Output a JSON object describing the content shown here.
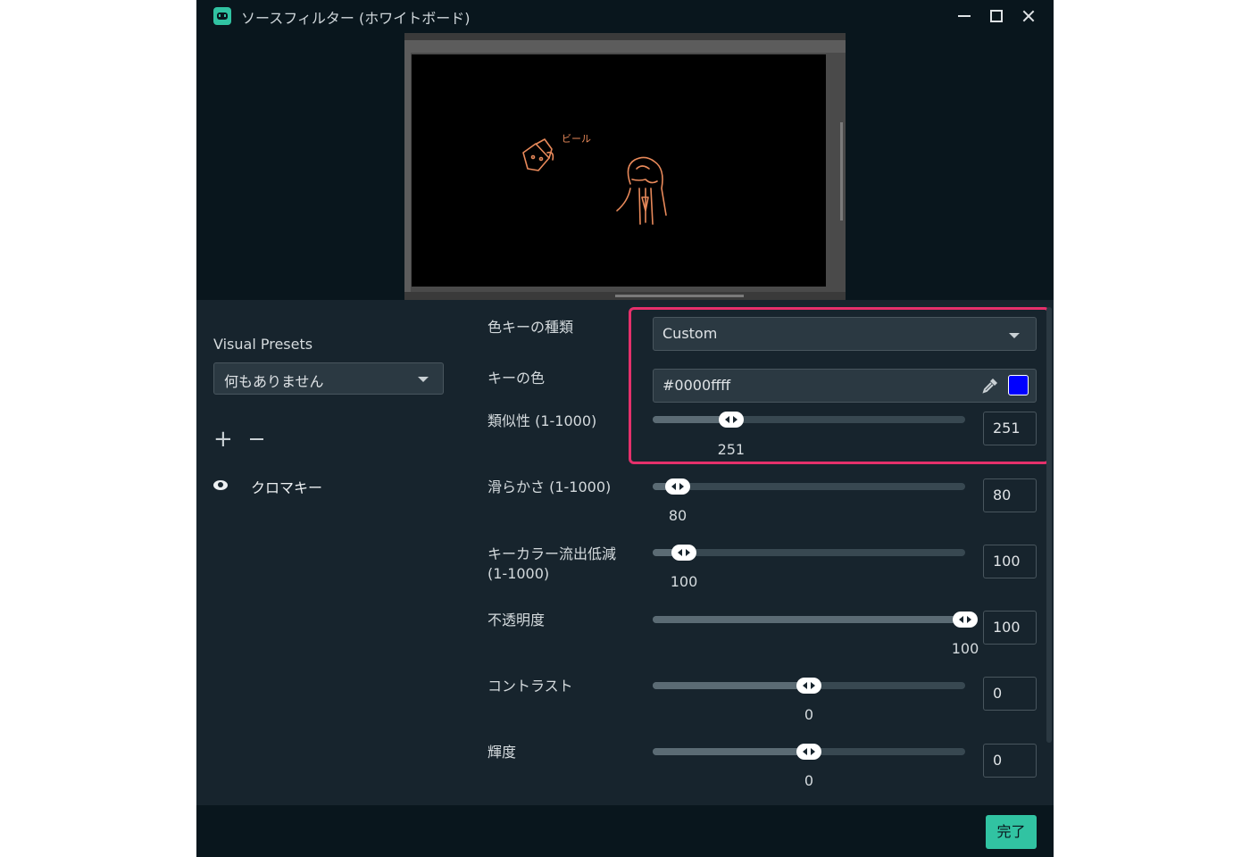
{
  "window": {
    "title": "ソースフィルター (ホワイトボード)",
    "controls": [
      "minimize",
      "maximize",
      "close"
    ]
  },
  "preview": {
    "annotation_text": "ビール",
    "doodle_color": "#e8895a"
  },
  "presets": {
    "label": "Visual Presets",
    "selected": "何もありません"
  },
  "filter_list": {
    "add_label": "+",
    "items": [
      {
        "name": "クロマキー",
        "visible": true
      }
    ]
  },
  "settings": {
    "key_type": {
      "label": "色キーの種類",
      "value": "Custom"
    },
    "key_color": {
      "label": "キーの色",
      "value": "#0000ffff",
      "swatch": "#0000ff"
    },
    "similarity": {
      "label": "類似性 (1-1000)",
      "value": "251",
      "fraction": 0.251
    },
    "smoothness": {
      "label": "滑らかさ (1-1000)",
      "value": "80",
      "fraction": 0.08
    },
    "spill": {
      "label_line1": "キーカラー流出低減",
      "label_line2": "(1-1000)",
      "value": "100",
      "fraction": 0.1
    },
    "opacity": {
      "label": "不透明度",
      "value": "100",
      "fraction": 1.0
    },
    "contrast": {
      "label": "コントラスト",
      "value": "0",
      "fraction": 0.5
    },
    "brightness": {
      "label": "輝度",
      "value": "0",
      "fraction": 0.5
    }
  },
  "footer": {
    "done_label": "完了"
  },
  "colors": {
    "accent": "#31c3a2",
    "highlight": "#e5306b",
    "background": "#17242d"
  }
}
